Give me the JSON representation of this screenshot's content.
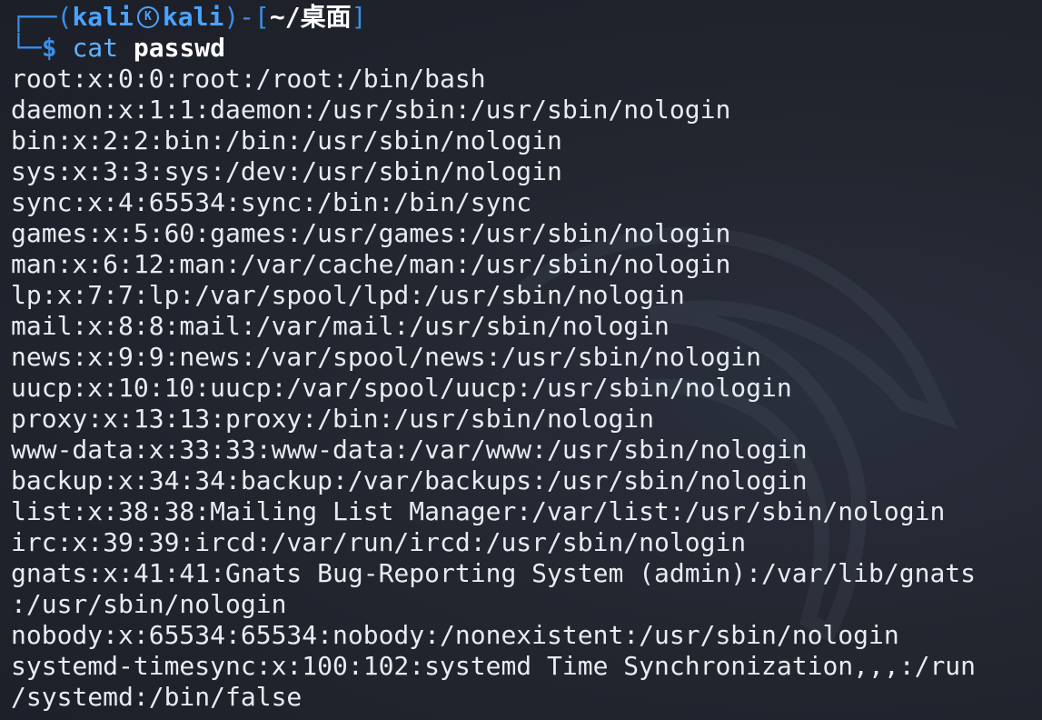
{
  "prompt": {
    "corner_top": "┌──(",
    "user": "kali",
    "host": "kali",
    "mid": ")-[",
    "dir": "~/桌面",
    "end": "]",
    "corner_bottom": "└─",
    "dollar": "$",
    "command": "cat",
    "argument": "passwd"
  },
  "output": [
    "root:x:0:0:root:/root:/bin/bash",
    "daemon:x:1:1:daemon:/usr/sbin:/usr/sbin/nologin",
    "bin:x:2:2:bin:/bin:/usr/sbin/nologin",
    "sys:x:3:3:sys:/dev:/usr/sbin/nologin",
    "sync:x:4:65534:sync:/bin:/bin/sync",
    "games:x:5:60:games:/usr/games:/usr/sbin/nologin",
    "man:x:6:12:man:/var/cache/man:/usr/sbin/nologin",
    "lp:x:7:7:lp:/var/spool/lpd:/usr/sbin/nologin",
    "mail:x:8:8:mail:/var/mail:/usr/sbin/nologin",
    "news:x:9:9:news:/var/spool/news:/usr/sbin/nologin",
    "uucp:x:10:10:uucp:/var/spool/uucp:/usr/sbin/nologin",
    "proxy:x:13:13:proxy:/bin:/usr/sbin/nologin",
    "www-data:x:33:33:www-data:/var/www:/usr/sbin/nologin",
    "backup:x:34:34:backup:/var/backups:/usr/sbin/nologin",
    "list:x:38:38:Mailing List Manager:/var/list:/usr/sbin/nologin",
    "irc:x:39:39:ircd:/var/run/ircd:/usr/sbin/nologin",
    "gnats:x:41:41:Gnats Bug-Reporting System (admin):/var/lib/gnats",
    ":/usr/sbin/nologin",
    "nobody:x:65534:65534:nobody:/nonexistent:/usr/sbin/nologin",
    "systemd-timesync:x:100:102:systemd Time Synchronization,,,:/run",
    "/systemd:/bin/false"
  ],
  "colors": {
    "background": "#1f2330",
    "prompt_accent": "#4aa3ff",
    "text": "#e8ecf2"
  },
  "icons": {
    "host_separator": "kali-logo-icon",
    "watermark": "kali-dragon-icon"
  }
}
